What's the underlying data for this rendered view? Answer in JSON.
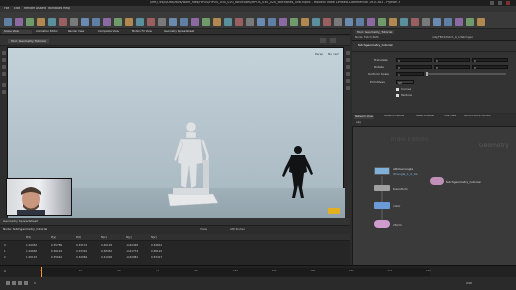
{
  "window": {
    "title": "(left) /cs/ti/Dtd/zavs/work_files/HPOS/HPOS_030_020_torchsites/HPOS_030_020_torchsites_006.hipnc - Houdini Indie Limited-Commercial 19.0.383 - Python 3"
  },
  "menu": [
    "File",
    "Edit",
    "Render",
    "Assets",
    "Windows",
    "Help"
  ],
  "pane_tabs_left": [
    "Scene View",
    "Animation Editor",
    "Render View",
    "Composite View",
    "Motion FX View",
    "Geometry Spreadsheet"
  ],
  "viewport": {
    "tab_label": "Tool: Geometry Tutorial",
    "camera_label": "Persp",
    "cam_label": "No cam"
  },
  "spreadsheet": {
    "node_label": "Node: fetchgeometry_tutorial",
    "view_label": "View",
    "attribs_label": "Attributes",
    "columns": [
      "",
      "P[x]",
      "P[y]",
      "P[z]",
      "N[x]",
      "N[y]",
      "N[z]"
    ],
    "rows": [
      [
        "0",
        "1.04952",
        "0.35789",
        "0.33172",
        "0.40193",
        "-0.62348",
        "0.54812"
      ],
      [
        "1",
        "1.04682",
        "0.36124",
        "0.33391",
        "0.38452",
        "-0.61774",
        "0.58122"
      ],
      [
        "2",
        "1.05115",
        "0.35642",
        "0.32984",
        "0.41026",
        "-0.62981",
        "0.53417"
      ]
    ]
  },
  "params": {
    "tab_label": "Tool: Geometry_Tutorial",
    "node_name": "fetchgeometry_tutorial",
    "path_label": "Node: Fetch Path",
    "path_value": "/obj/FBX1/fetch_0_1/fetchgeo",
    "rows": [
      {
        "label": "Translate",
        "values": [
          "0",
          "0",
          "0"
        ]
      },
      {
        "label": "Rotate",
        "values": [
          "0",
          "0",
          "0"
        ]
      },
      {
        "label": "Uniform Scale",
        "values": [
          "1"
        ]
      },
      {
        "label": "Primitives",
        "values": [
          "All"
        ]
      }
    ],
    "checks": [
      "Curves",
      "Texture"
    ]
  },
  "network": {
    "tabs": [
      "Network View",
      "Material Palette",
      "Asset Browser",
      "Tree View",
      "Performance Monitor"
    ],
    "path": "obj",
    "context_label": "Geometry",
    "watermark": "Indie Edition",
    "nodes": [
      {
        "label": "attribwrangle",
        "sub": "Wrangle_1_0_0a",
        "color": "#7fb0d8"
      },
      {
        "label": "fetchgeometry_tutorial",
        "sub": "",
        "color": "#c08fb8"
      },
      {
        "label": "transform",
        "sub": "",
        "color": "#a0a0a0"
      },
      {
        "label": "color",
        "sub": "",
        "color": "#6a9ad8"
      },
      {
        "label": "xform",
        "sub": "",
        "color": "#d09cd0"
      }
    ]
  },
  "timeline": {
    "frame": "1",
    "start": "1",
    "end": "240",
    "ticks": [
      "1",
      "24",
      "48",
      "72",
      "96",
      "120",
      "144",
      "168",
      "192",
      "216",
      "240"
    ]
  },
  "colors": {
    "viewport_top": "#c4d2da",
    "viewport_bottom": "#a6b6bf",
    "accent": "#ff9a2a",
    "panel": "#333333"
  }
}
